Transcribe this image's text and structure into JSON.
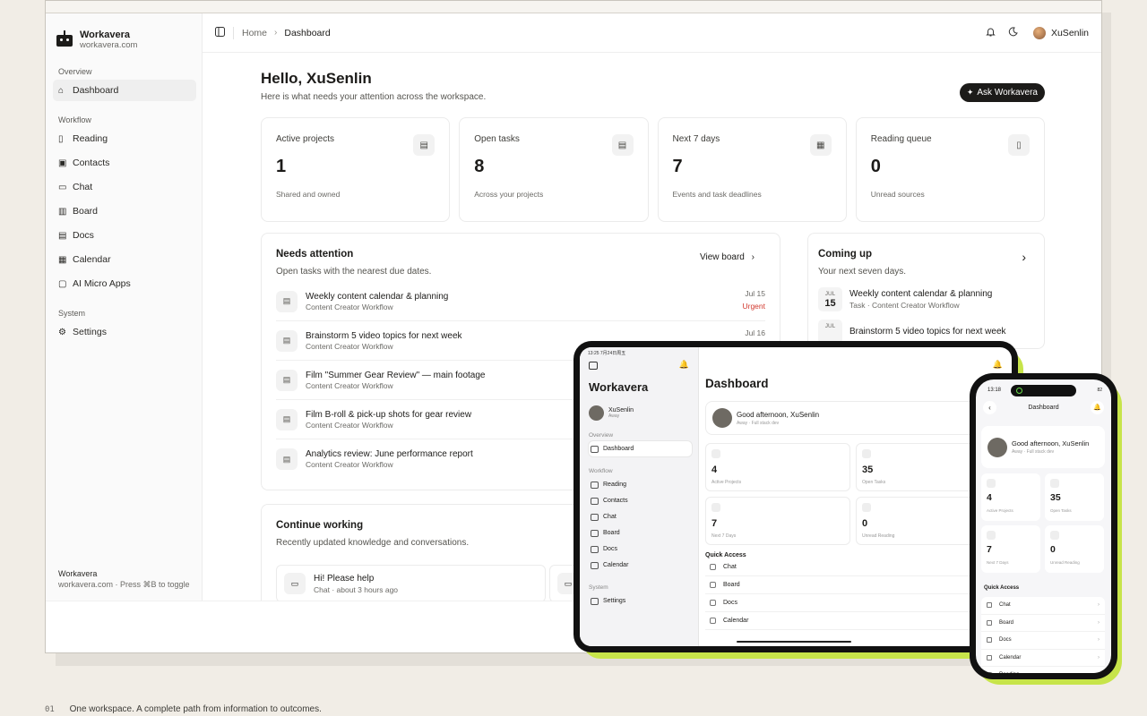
{
  "app": {
    "name": "Workavera",
    "domain": "workavera.com"
  },
  "sidebar": {
    "sections": [
      {
        "title": "Overview",
        "items": [
          {
            "label": "Dashboard",
            "icon": "home-icon",
            "active": true
          }
        ]
      },
      {
        "title": "Workflow",
        "items": [
          {
            "label": "Reading",
            "icon": "book-icon"
          },
          {
            "label": "Contacts",
            "icon": "contact-icon"
          },
          {
            "label": "Chat",
            "icon": "chat-icon"
          },
          {
            "label": "Board",
            "icon": "board-icon"
          },
          {
            "label": "Docs",
            "icon": "doc-icon"
          },
          {
            "label": "Calendar",
            "icon": "calendar-icon"
          },
          {
            "label": "AI Micro Apps",
            "icon": "apps-icon"
          }
        ]
      },
      {
        "title": "System",
        "items": [
          {
            "label": "Settings",
            "icon": "gear-icon"
          }
        ]
      }
    ],
    "footer_title": "Workavera",
    "footer_sub": "workavera.com · Press ⌘B to toggle"
  },
  "topbar": {
    "crumbs": [
      "Home",
      "Dashboard"
    ],
    "user": "XuSenlin"
  },
  "main": {
    "greeting": "Hello, XuSenlin",
    "subtitle": "Here is what needs your attention across the workspace.",
    "ask_button": "Ask Workavera",
    "stats": [
      {
        "label": "Active projects",
        "value": "1",
        "foot": "Shared and owned",
        "icon": "clipboard-icon"
      },
      {
        "label": "Open tasks",
        "value": "8",
        "foot": "Across your projects",
        "icon": "clipboard-icon"
      },
      {
        "label": "Next 7 days",
        "value": "7",
        "foot": "Events and task deadlines",
        "icon": "calendar-icon"
      },
      {
        "label": "Reading queue",
        "value": "0",
        "foot": "Unread sources",
        "icon": "book-icon"
      }
    ],
    "needs": {
      "title": "Needs attention",
      "subtitle": "Open tasks with the nearest due dates.",
      "view_board": "View board",
      "tasks": [
        {
          "title": "Weekly content calendar & planning",
          "project": "Content Creator Workflow",
          "date": "Jul 15",
          "flag": "Urgent"
        },
        {
          "title": "Brainstorm 5 video topics for next week",
          "project": "Content Creator Workflow",
          "date": "Jul 16",
          "flag": ""
        },
        {
          "title": "Film \"Summer Gear Review\" — main footage",
          "project": "Content Creator Workflow",
          "date": "",
          "flag": ""
        },
        {
          "title": "Film B-roll & pick-up shots for gear review",
          "project": "Content Creator Workflow",
          "date": "",
          "flag": ""
        },
        {
          "title": "Analytics review: June performance report",
          "project": "Content Creator Workflow",
          "date": "",
          "flag": ""
        }
      ]
    },
    "coming": {
      "title": "Coming up",
      "subtitle": "Your next seven days.",
      "items": [
        {
          "month": "JUL",
          "day": "15",
          "title": "Weekly content calendar & planning",
          "sub": "Task · Content Creator Workflow"
        },
        {
          "month": "JUL",
          "day": "",
          "title": "Brainstorm 5 video topics for next week",
          "sub": ""
        }
      ]
    },
    "continue": {
      "title": "Continue working",
      "subtitle": "Recently updated knowledge and conversations.",
      "cards": [
        {
          "title": "Hi! Please help",
          "sub": "Chat · about 3 hours ago"
        }
      ]
    }
  },
  "tablet": {
    "status_time": "13:25  7月24日周五",
    "brand": "Workavera",
    "user": "XuSenlin",
    "user_status": "Away",
    "sections": [
      {
        "title": "Overview",
        "items": [
          "Dashboard"
        ]
      },
      {
        "title": "Workflow",
        "items": [
          "Reading",
          "Contacts",
          "Chat",
          "Board",
          "Docs",
          "Calendar"
        ]
      },
      {
        "title": "System",
        "items": [
          "Settings"
        ]
      }
    ],
    "title": "Dashboard",
    "greeting": "Good afternoon, XuSenlin",
    "greeting_sub": "Away  ·  Full stack dev",
    "stats": [
      {
        "value": "4",
        "label": "Active Projects"
      },
      {
        "value": "35",
        "label": "Open Tasks"
      },
      {
        "value": "7",
        "label": "Next 7 Days"
      },
      {
        "value": "0",
        "label": "Unread Reading"
      }
    ],
    "quick_access": "Quick Access",
    "quick_items": [
      "Chat",
      "Board",
      "Docs",
      "Calendar"
    ]
  },
  "phone": {
    "time": "13:18",
    "battery": "82",
    "header": "Dashboard",
    "greeting": "Good afternoon, XuSenlin",
    "greeting_sub": "Away  ·  Full stack dev",
    "stats": [
      {
        "value": "4",
        "label": "Active Projects"
      },
      {
        "value": "35",
        "label": "Open Tasks"
      },
      {
        "value": "7",
        "label": "Next 7 Days"
      },
      {
        "value": "0",
        "label": "Unread Reading"
      }
    ],
    "quick_access": "Quick Access",
    "quick_items": [
      "Chat",
      "Board",
      "Docs",
      "Calendar",
      "Reading"
    ]
  },
  "tagline": {
    "num": "01",
    "text": "One workspace. A complete path from information to outcomes."
  },
  "colors": {
    "accent_lime": "#c7e44a",
    "urgent": "#d23a2f",
    "dark_button": "#1c1b19"
  }
}
